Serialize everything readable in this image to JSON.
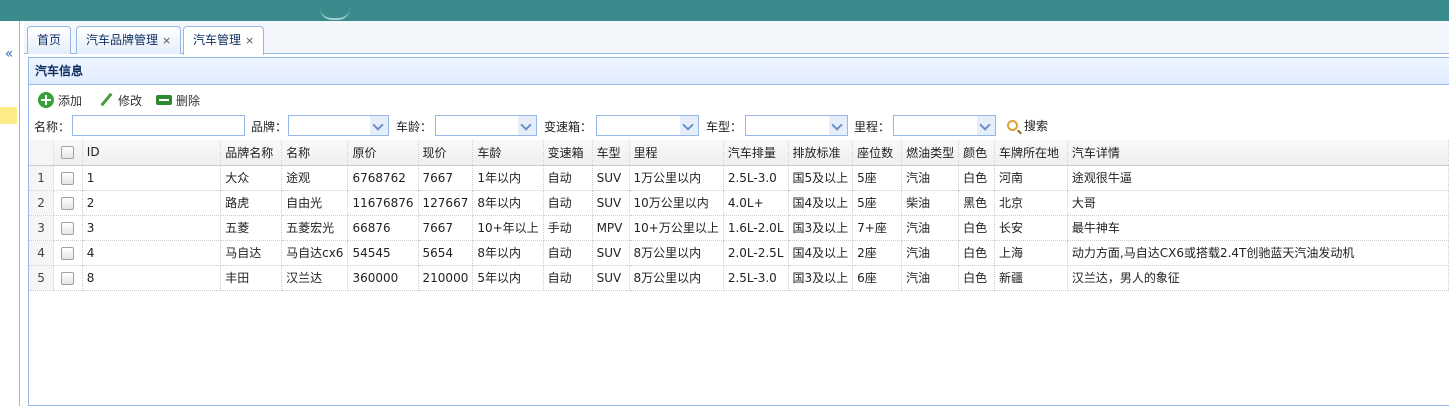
{
  "tabs": [
    {
      "label": "首页",
      "closable": false
    },
    {
      "label": "汽车品牌管理",
      "closable": true
    },
    {
      "label": "汽车管理",
      "closable": true,
      "active": true
    }
  ],
  "tab_close_glyph": "×",
  "sidebar": {
    "collapse_glyph": "«"
  },
  "panel": {
    "title": "汽车信息"
  },
  "toolbar": {
    "add": "添加",
    "edit": "修改",
    "delete": "删除"
  },
  "search": {
    "name_label": "名称：",
    "brand_label": "品牌：",
    "age_label": "车龄：",
    "gearbox_label": "变速箱：",
    "type_label": "车型：",
    "mileage_label": "里程：",
    "search_button": "搜索"
  },
  "table": {
    "columns": [
      "ID",
      "品牌名称",
      "名称",
      "原价",
      "现价",
      "车龄",
      "变速箱",
      "车型",
      "里程",
      "汽车排量",
      "排放标准",
      "座位数",
      "燃油类型",
      "颜色",
      "车牌所在地",
      "汽车详情"
    ],
    "rows": [
      {
        "rn": "1",
        "cells": [
          "1",
          "大众",
          "途观",
          "6768762",
          "7667",
          "1年以内",
          "自动",
          "SUV",
          "1万公里以内",
          "2.5L-3.0",
          "国5及以上",
          "5座",
          "汽油",
          "白色",
          "河南",
          "途观很牛逼"
        ]
      },
      {
        "rn": "2",
        "cells": [
          "2",
          "路虎",
          "自由光",
          "11676876",
          "127667",
          "8年以内",
          "自动",
          "SUV",
          "10万公里以内",
          "4.0L+",
          "国4及以上",
          "5座",
          "柴油",
          "黑色",
          "北京",
          "大哥"
        ]
      },
      {
        "rn": "3",
        "cells": [
          "3",
          "五菱",
          "五菱宏光",
          "66876",
          "7667",
          "10+年以上",
          "手动",
          "MPV",
          "10+万公里以上",
          "1.6L-2.0L",
          "国3及以上",
          "7+座",
          "汽油",
          "白色",
          "长安",
          "最牛神车"
        ]
      },
      {
        "rn": "4",
        "cells": [
          "4",
          "马自达",
          "马自达cx6",
          "54545",
          "5654",
          "8年以内",
          "自动",
          "SUV",
          "8万公里以内",
          "2.0L-2.5L",
          "国4及以上",
          "2座",
          "汽油",
          "白色",
          "上海",
          "动力方面,马自达CX6或搭载2.4T创驰蓝天汽油发动机"
        ]
      },
      {
        "rn": "5",
        "cells": [
          "8",
          "丰田",
          "汉兰达",
          "360000",
          "210000",
          "5年以内",
          "自动",
          "SUV",
          "8万公里以内",
          "2.5L-3.0",
          "国3及以上",
          "6座",
          "汽油",
          "白色",
          "新疆",
          "汉兰达，男人的象征"
        ]
      }
    ]
  }
}
